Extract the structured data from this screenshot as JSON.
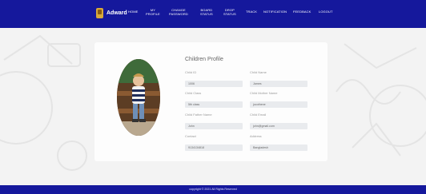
{
  "brand": {
    "name": "Adward"
  },
  "nav": {
    "home": [
      "HOME"
    ],
    "my_profile": [
      "MY",
      "PROFILE"
    ],
    "change_password": [
      "CHANGE",
      "PASSWORD"
    ],
    "board_status": [
      "BOARD",
      "STATUS"
    ],
    "drop_status": [
      "DROP",
      "STATUS"
    ],
    "track": [
      "TRACK"
    ],
    "notification": [
      "NOTIFICATION"
    ],
    "feedback": [
      "FEEDBACK"
    ],
    "logout": [
      "LOGOUT"
    ]
  },
  "profile": {
    "title": "Children Profile",
    "labels": {
      "child_id": "Child ID",
      "child_name": "Child Name",
      "child_class": "Child Class",
      "child_mother_name": "Child Mother Name",
      "child_father_name": "Child Father Name",
      "child_email": "Child Email",
      "contact": "Contact",
      "address": "Address"
    },
    "values": {
      "child_id": "1006",
      "child_name": "James",
      "child_class": "5th class",
      "child_mother_name": "jocothene",
      "child_father_name": "John",
      "child_email": "john@gmail.com",
      "contact": "9134134818",
      "address": "Bangladesh"
    }
  },
  "footer": {
    "text": "copyright © 2021 All Rights Reserved"
  },
  "colors": {
    "nav_bg": "#15189c",
    "page_bg": "#f3f3f3",
    "field_bg": "#e9ebee"
  }
}
